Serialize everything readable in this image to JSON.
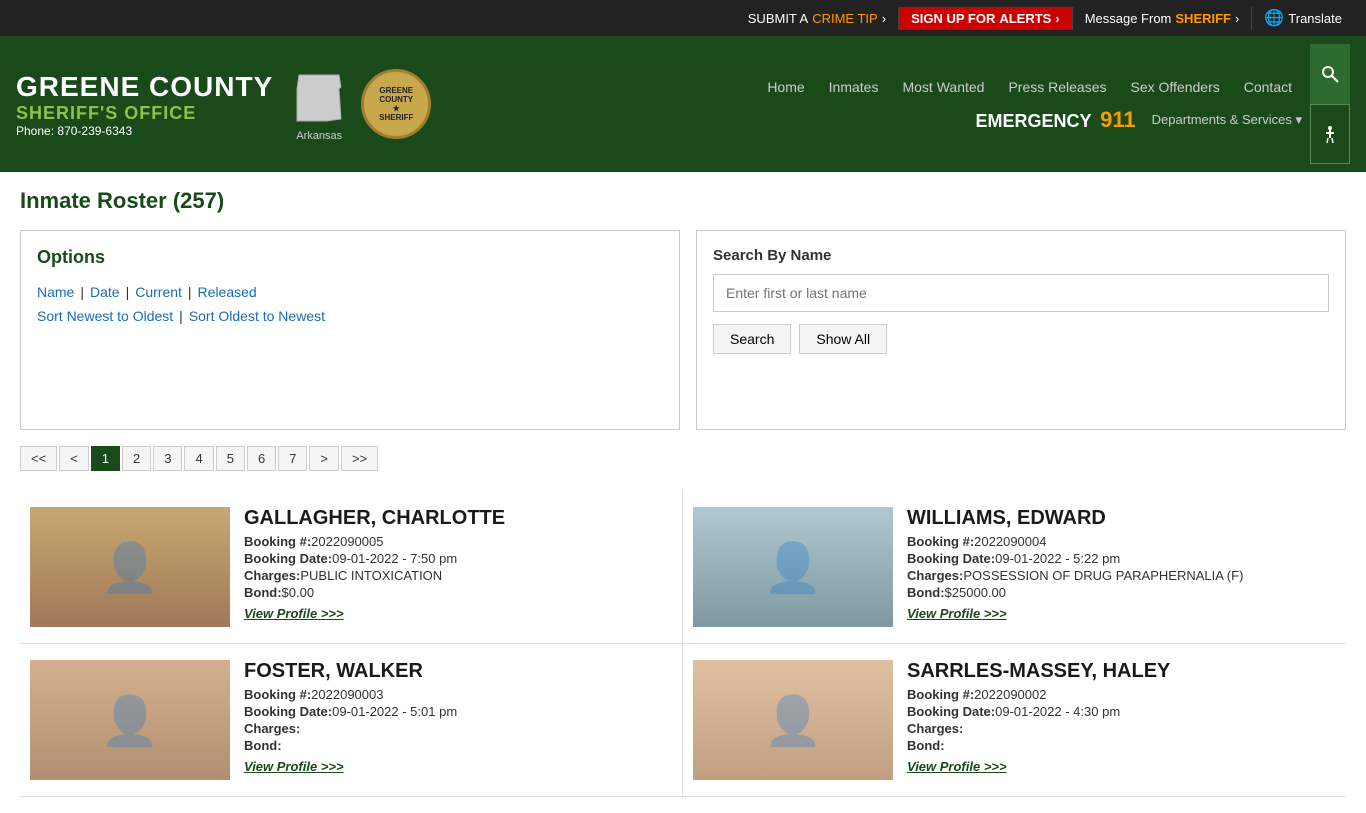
{
  "topbar": {
    "crime_tip": "SUBMIT A CRIME TIP >",
    "crime_tip_label1": "SUBMIT A ",
    "crime_tip_label2": "CRIME TIP",
    "crime_tip_arrow": ">",
    "alerts": "SIGN UP FOR ALERTS >",
    "alerts_label1": "SIGN UP FOR ",
    "alerts_label2": "ALERTS",
    "alerts_arrow": ">",
    "sheriff_msg_label1": "Message From ",
    "sheriff_msg_label2": "SHERIFF",
    "sheriff_msg_arrow": ">",
    "translate": "Translate"
  },
  "header": {
    "county": "GREENE COUNTY",
    "office": "SHERIFF'S OFFICE",
    "phone_label": "Phone:",
    "phone": "870-239-6343",
    "state_label": "Arkansas",
    "emergency_label": "EMERGENCY",
    "emergency_num": "911",
    "dept_services": "Departments & Services"
  },
  "nav": {
    "links": [
      {
        "label": "Home",
        "key": "home"
      },
      {
        "label": "Inmates",
        "key": "inmates"
      },
      {
        "label": "Most Wanted",
        "key": "most-wanted"
      },
      {
        "label": "Press Releases",
        "key": "press-releases"
      },
      {
        "label": "Sex Offenders",
        "key": "sex-offenders"
      },
      {
        "label": "Contact",
        "key": "contact"
      }
    ]
  },
  "page": {
    "title": "Inmate Roster (257)"
  },
  "options": {
    "title": "Options",
    "filter_links": [
      {
        "label": "Name",
        "key": "name"
      },
      {
        "label": "Date",
        "key": "date"
      },
      {
        "label": "Current",
        "key": "current"
      },
      {
        "label": "Released",
        "key": "released"
      }
    ],
    "sort_links": [
      {
        "label": "Sort Newest to Oldest",
        "key": "sort-newest"
      },
      {
        "label": "Sort Oldest to Newest",
        "key": "sort-oldest"
      }
    ]
  },
  "search": {
    "title": "Search By Name",
    "placeholder": "Enter first or last name",
    "search_btn": "Search",
    "show_all_btn": "Show All"
  },
  "pagination": {
    "first": "<<",
    "prev": "<",
    "pages": [
      "1",
      "2",
      "3",
      "4",
      "5",
      "6",
      "7"
    ],
    "active_page": "1",
    "next": ">",
    "last": ">>"
  },
  "inmates": [
    {
      "name": "GALLAGHER, CHARLOTTE",
      "booking_num_label": "Booking #:",
      "booking_num": "2022090005",
      "booking_date_label": "Booking Date:",
      "booking_date": "09-01-2022 - 7:50 pm",
      "charges_label": "Charges:",
      "charges": "PUBLIC INTOXICATION",
      "bond_label": "Bond:",
      "bond": "$0.00",
      "profile_link": "View Profile >>>",
      "photo_class": "photo-gallagher"
    },
    {
      "name": "WILLIAMS, EDWARD",
      "booking_num_label": "Booking #:",
      "booking_num": "2022090004",
      "booking_date_label": "Booking Date:",
      "booking_date": "09-01-2022 - 5:22 pm",
      "charges_label": "Charges:",
      "charges": "POSSESSION OF DRUG PARAPHERNALIA (F)",
      "bond_label": "Bond:",
      "bond": "$25000.00",
      "profile_link": "View Profile >>>",
      "photo_class": "photo-williams"
    },
    {
      "name": "FOSTER, WALKER",
      "booking_num_label": "Booking #:",
      "booking_num": "2022090003",
      "booking_date_label": "Booking Date:",
      "booking_date": "09-01-2022 - 5:01 pm",
      "charges_label": "Charges:",
      "charges": "",
      "bond_label": "Bond:",
      "bond": "",
      "profile_link": "View Profile >>>",
      "photo_class": "photo-foster"
    },
    {
      "name": "SARRLES-MASSEY, HALEY",
      "booking_num_label": "Booking #:",
      "booking_num": "2022090002",
      "booking_date_label": "Booking Date:",
      "booking_date": "09-01-2022 - 4:30 pm",
      "charges_label": "Charges:",
      "charges": "",
      "bond_label": "Bond:",
      "bond": "",
      "profile_link": "View Profile >>>",
      "photo_class": "photo-sarrles"
    }
  ]
}
